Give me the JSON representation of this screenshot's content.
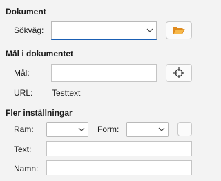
{
  "document_section": {
    "title": "Dokument",
    "path_label": "Sökväg:",
    "path_value": ""
  },
  "target_section": {
    "title": "Mål i dokumentet",
    "target_label": "Mål:",
    "target_value": "",
    "url_label": "URL:",
    "url_value": "Testtext"
  },
  "more_section": {
    "title": "Fler inställningar",
    "frame_label": "Ram:",
    "frame_value": "",
    "form_label": "Form:",
    "form_value": "",
    "text_label": "Text:",
    "text_value": "",
    "name_label": "Namn:",
    "name_value": ""
  },
  "icons": {
    "open_folder": "folder-open-icon",
    "target": "target-icon",
    "dropdown": "chevron-down-icon"
  },
  "colors": {
    "focus_underline": "#1a5fb4",
    "folder": "#f2a23a",
    "background": "#f3f3f3"
  }
}
